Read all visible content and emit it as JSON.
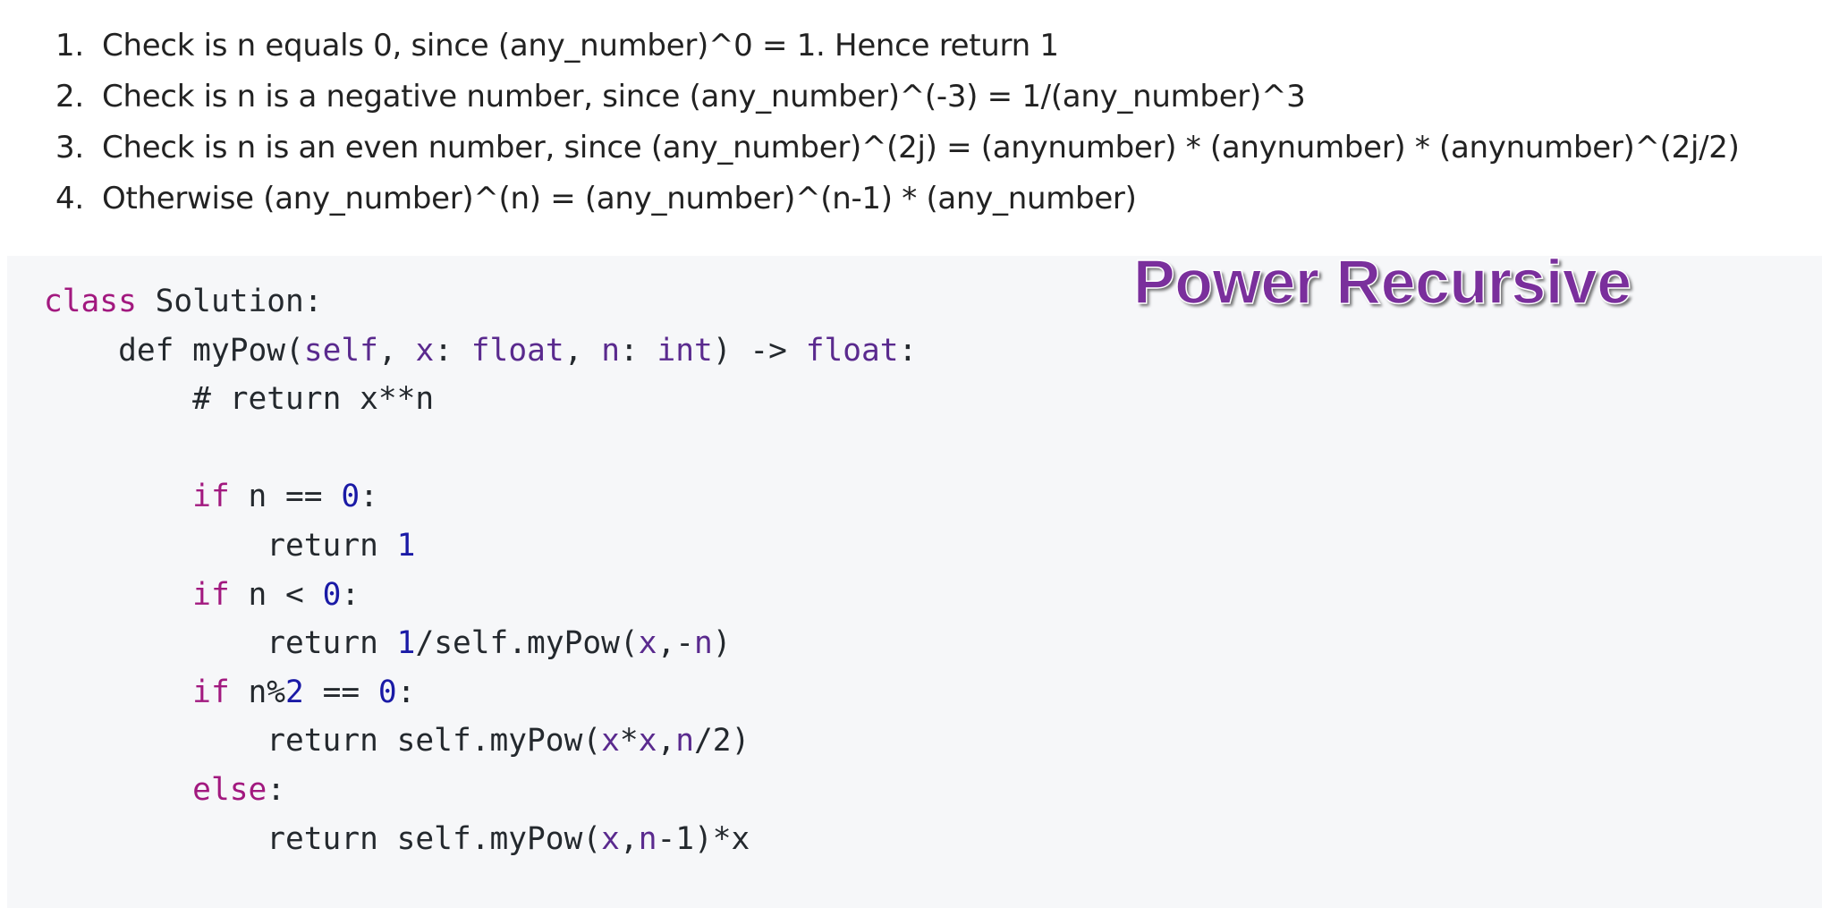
{
  "steps": [
    {
      "number": "1.",
      "text": "Check is n equals 0, since (any_number)^0 = 1. Hence return 1"
    },
    {
      "number": "2.",
      "text": "Check is n is a negative number, since (any_number)^(-3) = 1/(any_number)^3"
    },
    {
      "number": "3.",
      "text": "Check is n is an even number, since (any_number)^(2j) = (anynumber) * (anynumber) * (anynumber)^(2j/2)"
    },
    {
      "number": "4.",
      "text": "Otherwise (any_number)^(n) = (any_number)^(n-1) * (any_number)"
    }
  ],
  "banner": {
    "title": "Power Recursive"
  },
  "code": {
    "t": {
      "class_kw": "class",
      "class_name": " Solution:",
      "def": "def myPow(",
      "self": "self",
      "comma_sp": ", ",
      "x": "x",
      "colon_sp": ": ",
      "float": "float",
      "n": "n",
      "int": "int",
      "arrow": ") -> ",
      "colon": ":",
      "comment": "# return x**n",
      "if": "if",
      "n_eq": " n == ",
      "zero": "0",
      "return_sp": "return ",
      "one": "1",
      "n_lt": " n < ",
      "div_call": "/self.myPow(",
      "comma_neg": ",-",
      "close_paren": ")",
      "sp_n_mod": " n%",
      "two": "2",
      "eq_sp": " == ",
      "ret_call": "return self.myPow(",
      "star": "*",
      "comma": ",",
      "half": "/2)",
      "else": "else",
      "minus_one_times": "-1)*x"
    }
  }
}
